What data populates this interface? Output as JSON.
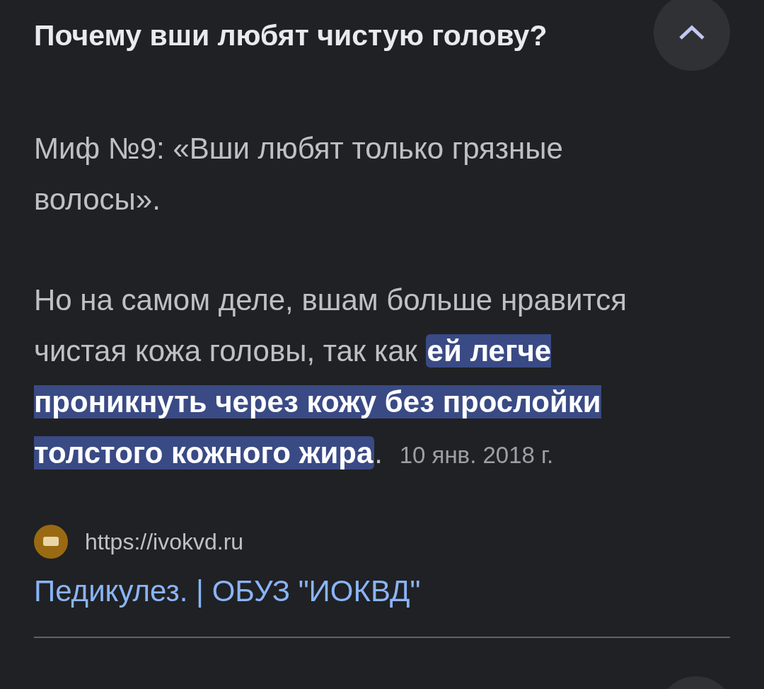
{
  "question": {
    "title": "Почему вши любят чистую голову?",
    "expanded": true
  },
  "answer": {
    "paragraphs": [
      "Миф №9: «Вши любят только грязные волосы»."
    ],
    "segments": [
      {
        "text": "Но на самом деле, вшам больше нравится чистая кожа головы, так как ",
        "highlighted": false
      },
      {
        "text": "ей легче проникнуть через кожу без прослойки толстого кожного жира",
        "highlighted": true
      },
      {
        "text": ".",
        "highlighted": false
      }
    ],
    "date": "10 янв. 2018 г."
  },
  "source": {
    "url": "https://ivokvd.ru",
    "link": "Педикулез. | ОБУЗ \"ИОКВД\""
  }
}
